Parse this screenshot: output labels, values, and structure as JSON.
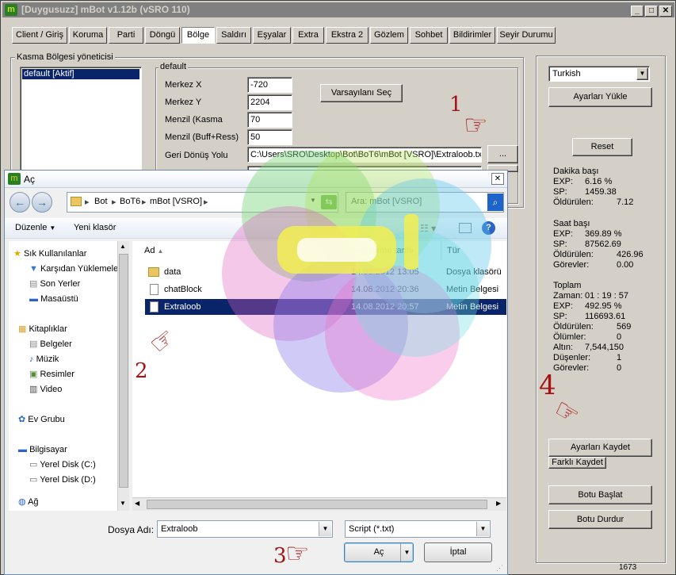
{
  "main_window": {
    "title": "[Duygusuzz] mBot v1.12b (vSRO 110)",
    "logo_letter": "m",
    "controls": {
      "minimize": "_",
      "maximize": "□",
      "close": "✕"
    }
  },
  "tabs": [
    {
      "label": "Client / Giriş"
    },
    {
      "label": "Koruma"
    },
    {
      "label": "Parti"
    },
    {
      "label": "Döngü"
    },
    {
      "label": "Bölge"
    },
    {
      "label": "Saldırı"
    },
    {
      "label": "Eşyalar"
    },
    {
      "label": "Extra"
    },
    {
      "label": "Ekstra 2"
    },
    {
      "label": "Gözlem"
    },
    {
      "label": "Sohbet"
    },
    {
      "label": "Bildirimler"
    },
    {
      "label": "Seyir Durumu"
    }
  ],
  "area_manager": {
    "group_label": "Kasma Bölgesi yöneticisi",
    "list_items": [
      "default [Aktif]"
    ],
    "detail_group_label": "default",
    "fields": {
      "center_x": {
        "label": "Merkez X",
        "value": "-720"
      },
      "center_y": {
        "label": "Merkez Y",
        "value": "2204"
      },
      "range": {
        "label": "Menzil (Kasma",
        "value": "70"
      },
      "range_buff": {
        "label": "Menzil (Buff+Ress)",
        "value": "50"
      },
      "return_path": {
        "label": "Geri Dönüş Yolu",
        "value": "C:\\Users\\SRO\\Desktop\\Bot\\BoT6\\mBot [VSRO]\\Extraloob.txt"
      }
    },
    "default_button": "Varsayılanı Seç",
    "browse_button": "..."
  },
  "right_panel": {
    "language": "Turkish",
    "load_settings": "Ayarları Yükle",
    "reset": "Reset",
    "per_minute": {
      "title": "Dakika başı",
      "exp": {
        "label": "EXP:",
        "value": "6.16 %"
      },
      "sp": {
        "label": "SP:",
        "value": "1459.38"
      },
      "kills": {
        "label": "Öldürülen:",
        "value": "7.12"
      }
    },
    "per_hour": {
      "title": "Saat başı",
      "exp": {
        "label": "EXP:",
        "value": "369.89 %"
      },
      "sp": {
        "label": "SP:",
        "value": "87562.69"
      },
      "kills": {
        "label": "Öldürülen:",
        "value": "426.96"
      },
      "quests": {
        "label": "Görevler:",
        "value": "0.00"
      }
    },
    "total": {
      "title": "Toplam",
      "time": {
        "label": "Zaman:",
        "value": "01 : 19 : 57"
      },
      "exp": {
        "label": "EXP:",
        "value": "492.95 %"
      },
      "sp": {
        "label": "SP:",
        "value": "116693.61"
      },
      "kills": {
        "label": "Öldürülen:",
        "value": "569"
      },
      "deaths": {
        "label": "Ölümler:",
        "value": "0"
      },
      "gold": {
        "label": "Altın:",
        "value": "7,544,150"
      },
      "drops": {
        "label": "Düşenler:",
        "value": "1"
      },
      "quests": {
        "label": "Görevler:",
        "value": "0"
      }
    },
    "save_settings": "Ayarları Kaydet",
    "save_as": "Farklı Kaydet",
    "start_bot": "Botu Başlat",
    "stop_bot": "Botu Durdur",
    "status_number": "1673"
  },
  "open_dialog": {
    "title": "Aç",
    "breadcrumb": [
      "Bot",
      "BoT6",
      "mBot [VSRO]"
    ],
    "search_placeholder": "Ara: mBot [VSRO]",
    "organize": "Düzenle",
    "new_folder": "Yeni klasör",
    "nav": {
      "favorites": "Sık Kullanılanlar",
      "downloads": "Karşıdan Yüklemeler",
      "recent": "Son Yerler",
      "desktop": "Masaüstü",
      "libraries": "Kitaplıklar",
      "documents": "Belgeler",
      "music": "Müzik",
      "pictures": "Resimler",
      "video": "Video",
      "homegroup": "Ev Grubu",
      "computer": "Bilgisayar",
      "disk_c": "Yerel Disk (C:)",
      "disk_d": "Yerel Disk (D:)",
      "network": "Ağ"
    },
    "columns": {
      "name": "Ad",
      "modified": "Değiştirme tarihi",
      "type": "Tür"
    },
    "files": [
      {
        "name": "data",
        "modified": "14.08.2012 13:05",
        "type": "Dosya klasörü",
        "icon": "folder-icon"
      },
      {
        "name": "chatBlock",
        "modified": "14.08.2012 20:36",
        "type": "Metin Belgesi",
        "icon": "text-file-icon"
      },
      {
        "name": "Extraloob",
        "modified": "14.08.2012 20:57",
        "type": "Metin Belgesi",
        "icon": "text-file-icon",
        "selected": true
      }
    ],
    "filename_label": "Dosya Adı:",
    "filename_value": "Extraloob",
    "filter_value": "Script (*.txt)",
    "open_button": "Aç",
    "cancel_button": "İptal"
  },
  "annotations": {
    "step1": "1",
    "step2": "2",
    "step3": "3",
    "step4": "4"
  },
  "colors": {
    "selection": "#0a246a",
    "annotation": "#a31515",
    "window_face": "#d4d0c8"
  }
}
